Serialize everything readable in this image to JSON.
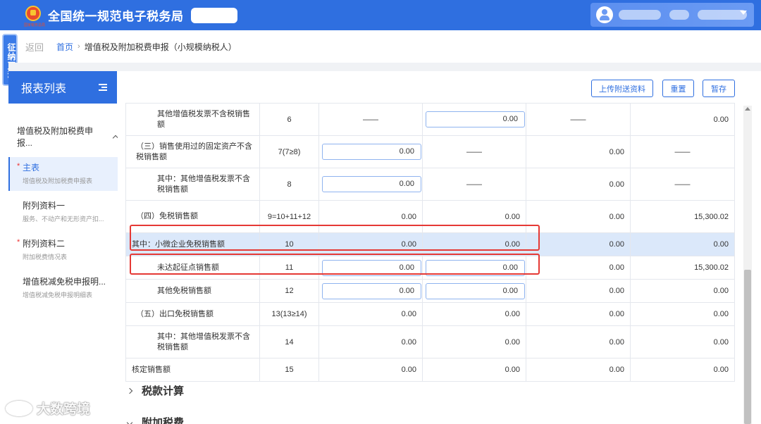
{
  "header": {
    "logo_text": "国家税务总局",
    "title": "全国统一规范电子税务局",
    "colors": {
      "primary": "#2f6fe0",
      "highlight_row": "#dbe8fa",
      "annotation_red": "#e53935"
    }
  },
  "side_tag": {
    "label": "征纳互动"
  },
  "breadcrumb": {
    "back": "返回",
    "home": "首页",
    "separator": "›",
    "current": "增值税及附加税费申报（小规模纳税人）"
  },
  "left_panel": {
    "title": "报表列表",
    "group": "增值税及附加税费申报...",
    "items": [
      {
        "name": "主表",
        "sub": "增值税及附加税费申报表",
        "required": "*",
        "active": true
      },
      {
        "name": "附列资料一",
        "sub": "服务、不动产和无形资产扣...",
        "required": "",
        "active": false
      },
      {
        "name": "附列资料二",
        "sub": "附加税费情况表",
        "required": "*",
        "active": false
      },
      {
        "name": "增值税减免税申报明...",
        "sub": "增值税减免税申报明细表",
        "required": "",
        "active": false
      }
    ]
  },
  "toolbar": {
    "upload": "上传附送资料",
    "reset": "重置",
    "save": "暂存"
  },
  "table": {
    "rows": [
      {
        "label": "其他增值税发票不含税销售额",
        "num": "6",
        "c1": "——",
        "c2": "0.00",
        "c3": "——",
        "c4": "0.00",
        "inputs": [
          false,
          true
        ]
      },
      {
        "label": "（三）销售使用过的固定资产不含税销售额",
        "num": "7(7≥8)",
        "c1": "0.00",
        "c2": "——",
        "c3": "0.00",
        "c4": "——",
        "inputs": [
          true,
          false
        ]
      },
      {
        "label": "其中：其他增值税发票不含税销售额",
        "num": "8",
        "c1": "0.00",
        "c2": "——",
        "c3": "0.00",
        "c4": "——",
        "inputs": [
          true,
          false
        ]
      },
      {
        "label": "（四）免税销售额",
        "num": "9=10+11+12",
        "c1": "0.00",
        "c2": "0.00",
        "c3": "0.00",
        "c4": "15,300.02",
        "inputs": [
          false,
          false
        ]
      },
      {
        "label": "其中：小微企业免税销售额",
        "num": "10",
        "c1": "0.00",
        "c2": "0.00",
        "c3": "0.00",
        "c4": "0.00",
        "inputs": [
          false,
          false
        ]
      },
      {
        "label": "未达起征点销售额",
        "num": "11",
        "c1": "0.00",
        "c2": "0.00",
        "c3": "0.00",
        "c4": "15,300.02",
        "inputs": [
          true,
          true
        ]
      },
      {
        "label": "其他免税销售额",
        "num": "12",
        "c1": "0.00",
        "c2": "0.00",
        "c3": "0.00",
        "c4": "0.00",
        "inputs": [
          true,
          true
        ]
      },
      {
        "label": "（五）出口免税销售额",
        "num": "13(13≥14)",
        "c1": "0.00",
        "c2": "0.00",
        "c3": "0.00",
        "c4": "0.00",
        "inputs": [
          false,
          false
        ]
      },
      {
        "label": "其中：其他增值税发票不含税销售额",
        "num": "14",
        "c1": "0.00",
        "c2": "0.00",
        "c3": "0.00",
        "c4": "0.00",
        "inputs": [
          false,
          false
        ]
      },
      {
        "label": "核定销售额",
        "num": "15",
        "c1": "0.00",
        "c2": "0.00",
        "c3": "0.00",
        "c4": "0.00",
        "inputs": [
          false,
          false
        ]
      }
    ]
  },
  "sections": {
    "tax_calc": "税款计算",
    "surcharge": "附加税费"
  },
  "watermark": {
    "text": "大数跨境"
  }
}
